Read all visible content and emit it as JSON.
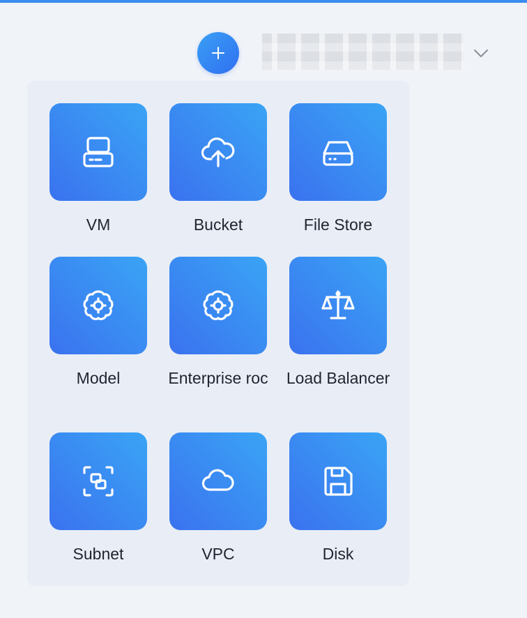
{
  "header": {
    "add_button_label": "+",
    "account_name": "",
    "accent_color": "#3b8cf0"
  },
  "menu": {
    "tiles": [
      {
        "label": "VM",
        "icon": "server-icon"
      },
      {
        "label": "Bucket",
        "icon": "cloud-upload-icon"
      },
      {
        "label": "File Store",
        "icon": "hard-drive-icon"
      },
      {
        "label": "Model",
        "icon": "brain-gear-icon"
      },
      {
        "label": "Enterprise roc",
        "icon": "brain-gear-icon"
      },
      {
        "label": "Load Balancer",
        "icon": "scale-icon"
      },
      {
        "label": "Subnet",
        "icon": "subnet-focus-icon"
      },
      {
        "label": "VPC",
        "icon": "cloud-icon"
      },
      {
        "label": "Disk",
        "icon": "save-disk-icon"
      }
    ],
    "tile_gradient": [
      "#3a72ef",
      "#3aa4f5"
    ]
  }
}
